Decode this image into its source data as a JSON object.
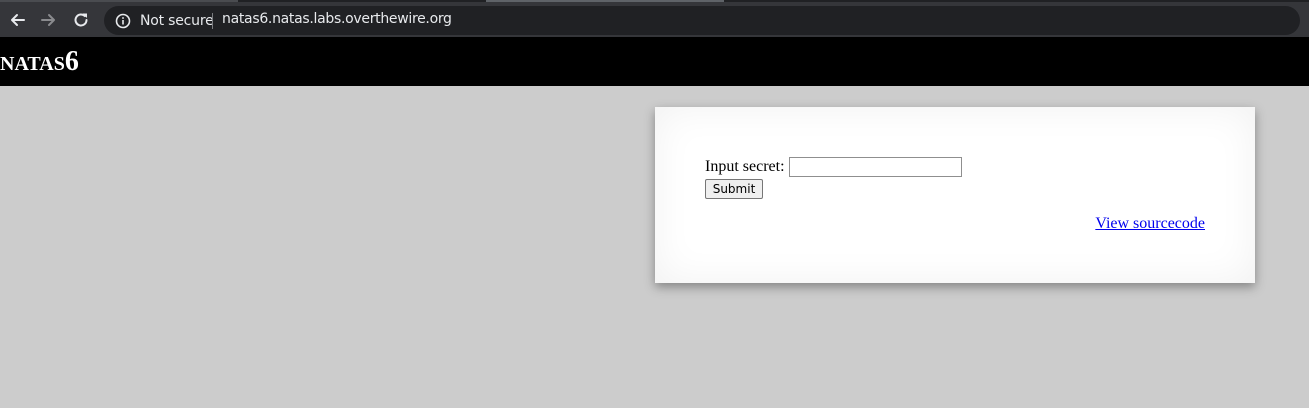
{
  "browser": {
    "security_label": "Not secure",
    "url": "natas6.natas.labs.overthewire.org",
    "icons": {
      "back": "back-arrow-icon",
      "forward": "forward-arrow-icon",
      "reload": "reload-icon",
      "site_info": "info-icon"
    },
    "colors": {
      "toolbar": "#35363a",
      "omnibox": "#202124",
      "text": "#e8eaed"
    }
  },
  "page": {
    "title": "natas6",
    "form": {
      "label": "Input secret:",
      "input_value": "",
      "submit_label": "Submit"
    },
    "source_link": "View sourcecode",
    "colors": {
      "background": "#cccccc",
      "header": "#000000",
      "panel": "#ffffff",
      "link": "#0000ee"
    }
  }
}
